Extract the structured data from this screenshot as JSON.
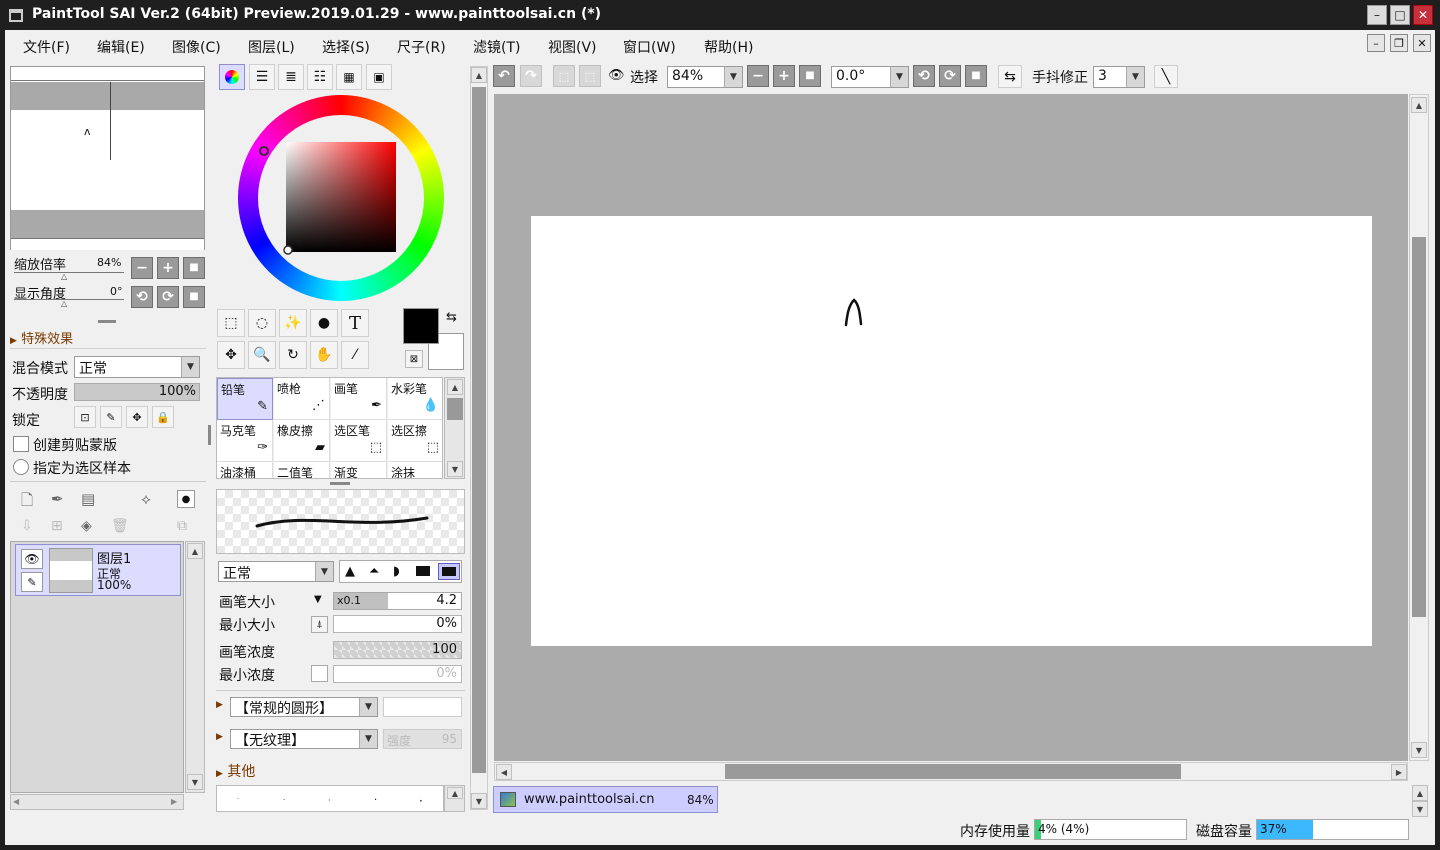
{
  "window": {
    "title": "PaintTool SAI Ver.2 (64bit) Preview.2019.01.29 - www.painttoolsai.cn (*)",
    "minimize": "–",
    "maximize": "□",
    "close": "✕"
  },
  "menu": [
    "文件(F)",
    "编辑(E)",
    "图像(C)",
    "图层(L)",
    "选择(S)",
    "尺子(R)",
    "滤镜(T)",
    "视图(V)",
    "窗口(W)",
    "帮助(H)"
  ],
  "navigator": {
    "zoom_label": "缩放倍率",
    "zoom_value": "84%",
    "angle_label": "显示角度",
    "angle_value": "0°",
    "mini_stroke": "ʌ"
  },
  "layer_props": {
    "effects_label": "特殊效果",
    "blend_label": "混合模式",
    "blend_value": "正常",
    "opacity_label": "不透明度",
    "opacity_value": "100%",
    "opacity_level": 1.0,
    "lock_label": "锁定",
    "clip_label": "创建剪贴蒙版",
    "selection_source_label": "指定为选区样本"
  },
  "layers": [
    {
      "name": "图层1",
      "mode": "正常",
      "opacity": "100%"
    }
  ],
  "color": {
    "foreground": "#000000",
    "background": "#ffffff",
    "hue_base": "#ff0000"
  },
  "brushes": [
    {
      "name": "铅笔",
      "selected": true
    },
    {
      "name": "喷枪",
      "selected": false
    },
    {
      "name": "画笔",
      "selected": false
    },
    {
      "name": "水彩笔",
      "selected": false
    },
    {
      "name": "马克笔",
      "selected": false
    },
    {
      "name": "橡皮擦",
      "selected": false
    },
    {
      "name": "选区笔",
      "selected": false
    },
    {
      "name": "选区擦",
      "selected": false
    },
    {
      "name": "油漆桶",
      "selected": false
    },
    {
      "name": "二值笔",
      "selected": false
    },
    {
      "name": "渐变",
      "selected": false
    },
    {
      "name": "涂抹",
      "selected": false
    }
  ],
  "brush_settings": {
    "mode_value": "正常",
    "size_label": "画笔大小",
    "size_multiplier": "x0.1",
    "size_value": "4.2",
    "min_size_label": "最小大小",
    "min_size_value": "0%",
    "density_label": "画笔浓度",
    "density_value": "100",
    "min_density_label": "最小浓度",
    "min_density_value": "0%",
    "shape_value": "【常规的圆形】",
    "texture_value": "【无纹理】",
    "texture_strength_label": "强度",
    "texture_strength_value": "95",
    "other_label": "其他"
  },
  "canvas_toolbar": {
    "selection_label": "选择",
    "zoom_value": "84%",
    "angle_value": "0.0°",
    "stabilizer_label": "手抖修正",
    "stabilizer_value": "3"
  },
  "document_tab": {
    "name": "www.painttoolsai.cn",
    "zoom": "84%"
  },
  "status": {
    "memory_label": "内存使用量",
    "memory_value": "4% (4%)",
    "memory_level": 0.04,
    "disk_label": "磁盘容量",
    "disk_value": "37%",
    "disk_level": 0.37
  }
}
